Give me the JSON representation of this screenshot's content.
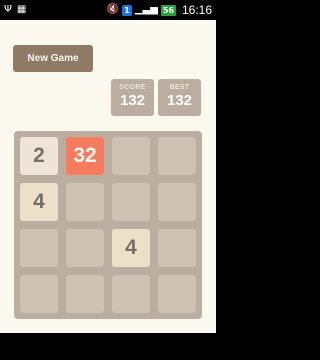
{
  "status_bar": {
    "left_icons": [
      "usb-icon",
      "screenshot-icon"
    ],
    "right_icons": [
      "mute-icon",
      "wifi-icon",
      "signal-icon",
      "battery-icon"
    ],
    "badge_text": "1",
    "battery_level": "56",
    "time": "16:16"
  },
  "game": {
    "new_game_label": "New Game",
    "score_label": "SCORE",
    "score_value": "132",
    "best_label": "BEST",
    "best_value": "132",
    "grid_size": 4,
    "tiles": [
      {
        "row": 0,
        "col": 0,
        "value": "2"
      },
      {
        "row": 0,
        "col": 1,
        "value": "32"
      },
      {
        "row": 1,
        "col": 0,
        "value": "4"
      },
      {
        "row": 2,
        "col": 2,
        "value": "4"
      }
    ],
    "colors": {
      "background": "#faf8ef",
      "board": "#bbada0",
      "empty_cell": "#cdc1b4",
      "button": "#8f7a66",
      "tile_2": "#eee4da",
      "tile_4": "#ede0c8",
      "tile_32": "#f67c5f",
      "dark_text": "#776e65",
      "light_text": "#f9f6f2"
    }
  }
}
